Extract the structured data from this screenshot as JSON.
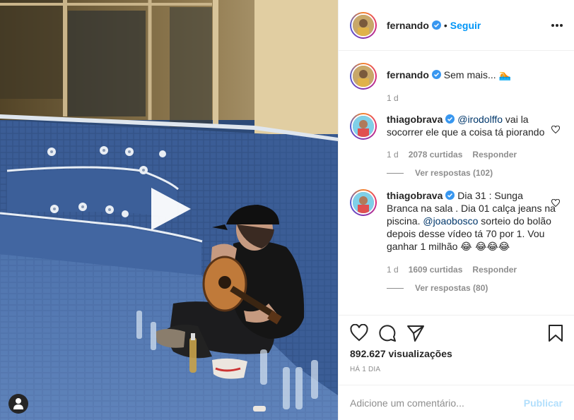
{
  "header": {
    "username": "fernando",
    "dot": "•",
    "follow_label": "Seguir"
  },
  "caption": {
    "username": "fernando",
    "text": "Sem mais...",
    "emoji": "🏊",
    "time": "1 d"
  },
  "comments": [
    {
      "username": "thiagobrava",
      "mention": "@irodolffo",
      "text": "vai la socorrer ele que a coisa tá piorando",
      "time": "1 d",
      "likes": "2078 curtidas",
      "reply_label": "Responder",
      "view_replies": "Ver respostas (102)"
    },
    {
      "username": "thiagobrava",
      "text_before": "Dia 31 : Sunga Branca na sala . Dia 01 calça jeans na piscina.",
      "mention": "@joaobosco",
      "text_after": "sorteio do bolão depois desse vídeo tá 70 por 1. Vou ganhar 1 milhão",
      "emoji": "😂 😂😂😂",
      "time": "1 d",
      "likes": "1609 curtidas",
      "reply_label": "Responder",
      "view_replies": "Ver respostas (80)"
    }
  ],
  "stats": {
    "views": "892.627 visualizações",
    "time_ago": "HÁ 1 DIA"
  },
  "add_comment": {
    "placeholder": "Adicione um comentário...",
    "publish_label": "Publicar"
  },
  "icons": {
    "like": "heart-icon",
    "comment": "comment-icon",
    "share": "share-icon",
    "save": "bookmark-icon",
    "more": "more-options-icon",
    "play": "play-icon",
    "tag": "user-tag-icon",
    "verified": "verified-badge-icon"
  },
  "colors": {
    "link": "#0095f6",
    "publish_disabled": "#b2dffc",
    "muted": "#8e8e8e",
    "mention": "#00376b",
    "verified": "#3897f0"
  }
}
